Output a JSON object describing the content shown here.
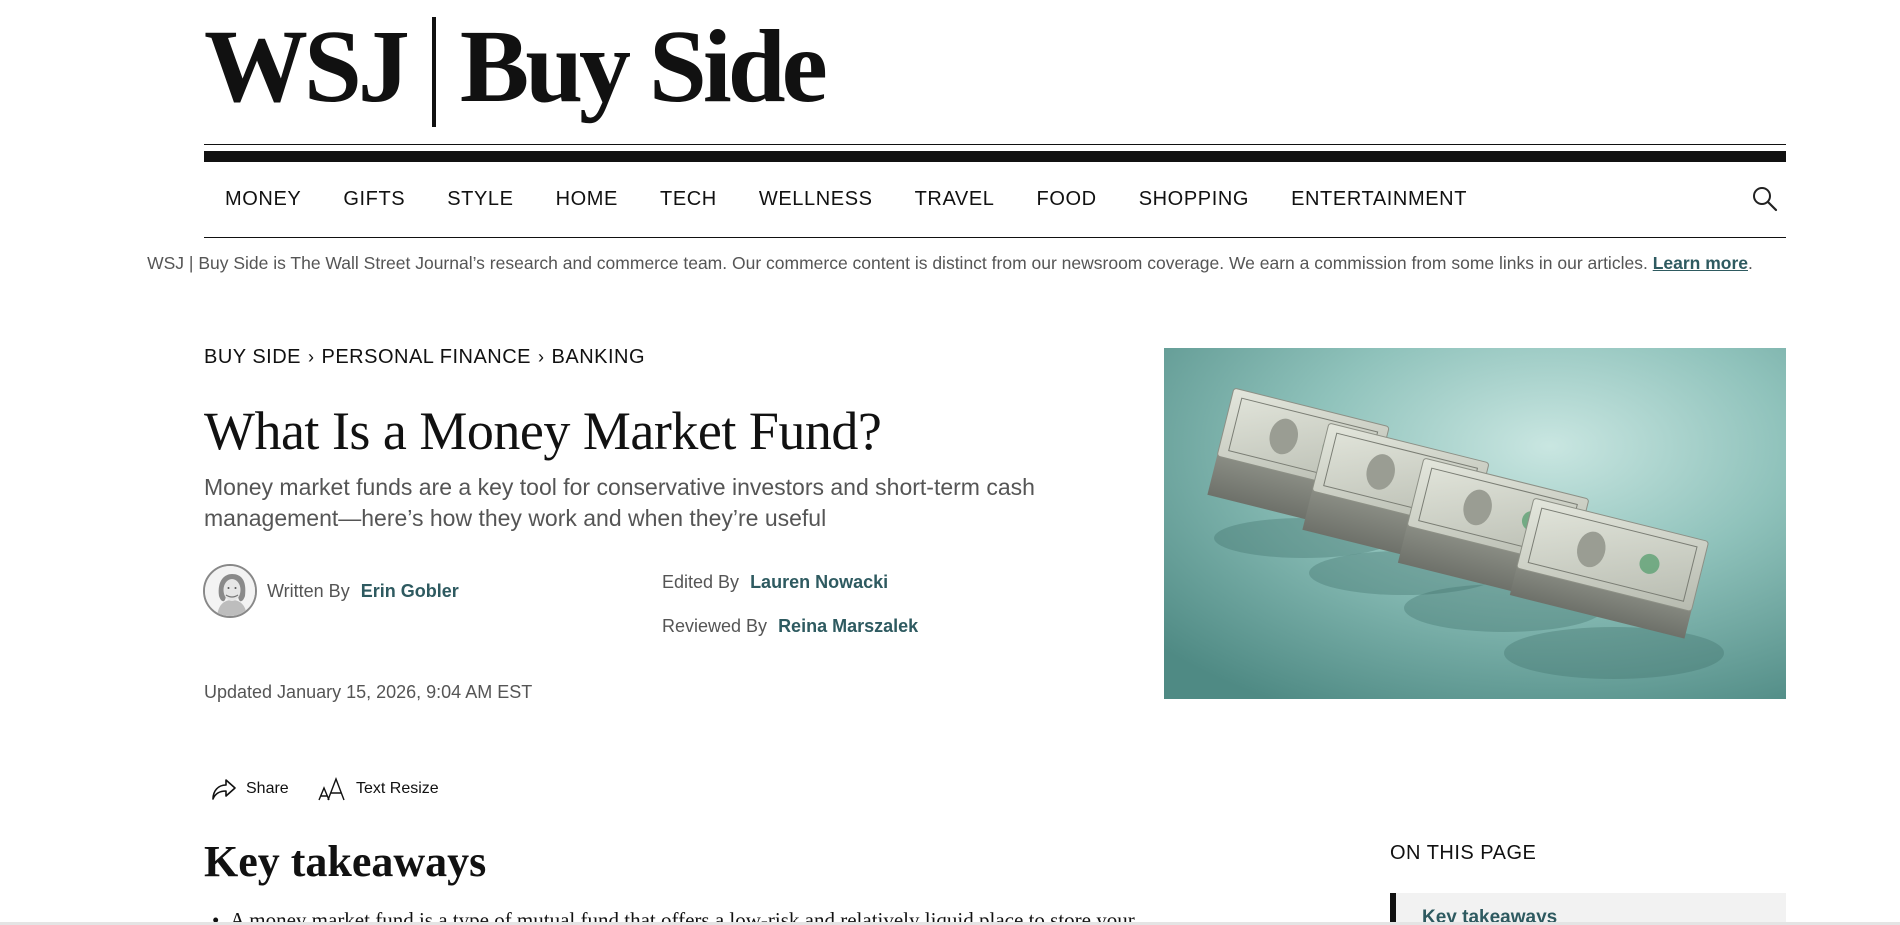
{
  "masthead": {
    "logo_left": "WSJ",
    "logo_right": "Buy Side"
  },
  "nav": {
    "items": [
      "MONEY",
      "GIFTS",
      "STYLE",
      "HOME",
      "TECH",
      "WELLNESS",
      "TRAVEL",
      "FOOD",
      "SHOPPING",
      "ENTERTAINMENT"
    ],
    "search_icon": "search-icon"
  },
  "disclaimer": {
    "text": "WSJ | Buy Side is The Wall Street Journal’s research and commerce team. Our commerce content is distinct from our newsroom coverage. We earn a commission from some links in our articles.",
    "link": "Learn more",
    "end": "."
  },
  "breadcrumb": [
    "BUY SIDE",
    "PERSONAL FINANCE",
    "BANKING"
  ],
  "article": {
    "title": "What Is a Money Market Fund?",
    "dek": "Money market funds are a key tool for conservative investors and short-term cash management—here’s how they work and when they’re useful",
    "written_by_label": "Written By",
    "author": "Erin Gobler",
    "edited_by_label": "Edited By",
    "editor": "Lauren Nowacki",
    "reviewed_by_label": "Reviewed By",
    "reviewer": "Reina Marszalek",
    "updated": "Updated January 15, 2026, 9:04 AM EST"
  },
  "tools": {
    "share": "Share",
    "text_resize": "Text Resize"
  },
  "key_takeaways": {
    "heading": "Key takeaways",
    "bullets": [
      "A money market fund is a type of mutual fund that offers a low-risk and relatively liquid place to store your"
    ]
  },
  "on_this_page": {
    "heading": "ON THIS PAGE",
    "items": [
      "Key takeaways"
    ]
  },
  "colors": {
    "accent": "#2e5a60",
    "text": "#111111",
    "muted": "#555555",
    "hero_bg": "#7fb3ad"
  }
}
